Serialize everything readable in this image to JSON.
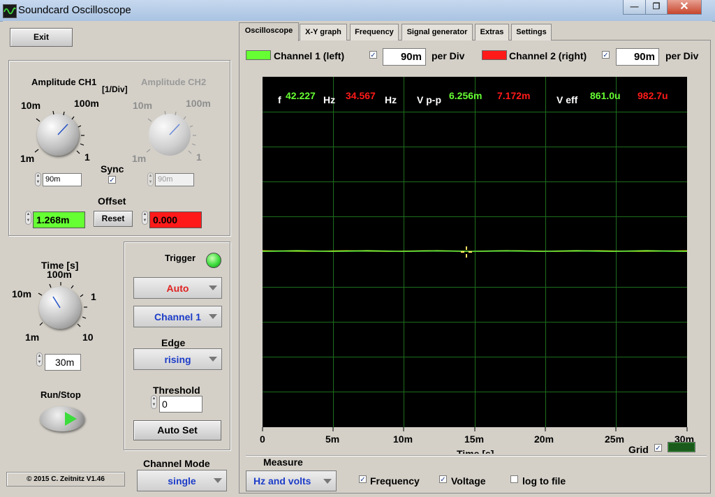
{
  "window": {
    "title": "Soundcard Oscilloscope"
  },
  "left": {
    "exit_label": "Exit",
    "amp_ch1_label": "Amplitude CH1",
    "amp_unit_label": "[1/Div]",
    "amp_ch2_label": "Amplitude CH2",
    "knob_ticks": {
      "t10m": "10m",
      "t100m": "100m",
      "t1m": "1m",
      "t1": "1"
    },
    "sync_label": "Sync",
    "ch1_amp_value": "90m",
    "ch2_amp_value": "90m",
    "offset_label": "Offset",
    "offset_ch1": "1.268m",
    "offset_ch2": "0.000",
    "reset_label": "Reset",
    "time_label": "Time [s]",
    "time_ticks": {
      "t100m": "100m",
      "t10m": "10m",
      "t1": "1",
      "t1m": "1m",
      "t10": "10"
    },
    "time_value": "30m",
    "runstop_label": "Run/Stop",
    "copyright": "© 2015  C. Zeitnitz V1.46",
    "channel_mode_label": "Channel Mode",
    "channel_mode_value": "single"
  },
  "trigger": {
    "label": "Trigger",
    "mode": "Auto",
    "channel": "Channel 1",
    "edge_label": "Edge",
    "edge": "rising",
    "threshold_label": "Threshold",
    "threshold_value": "0",
    "autoset_label": "Auto Set"
  },
  "tabs": [
    "Oscilloscope",
    "X-Y graph",
    "Frequency",
    "Signal generator",
    "Extras",
    "Settings"
  ],
  "channels": {
    "ch1_label": "Channel 1 (left)",
    "ch1_div": "90m",
    "ch2_label": "Channel 2 (right)",
    "ch2_div": "90m",
    "per_div": "per Div",
    "ch1_color": "#66ff33",
    "ch2_color": "#ff1a1a"
  },
  "measurements": {
    "f_label": "f",
    "f1": "42.227",
    "hz1": "Hz",
    "f2": "34.567",
    "hz2": "Hz",
    "vpp_label": "V p-p",
    "vpp1": "6.256m",
    "vpp2": "7.172m",
    "veff_label": "V eff",
    "veff1": "861.0u",
    "veff2": "982.7u"
  },
  "xaxis": {
    "ticks": [
      "0",
      "5m",
      "10m",
      "15m",
      "20m",
      "25m",
      "30m"
    ],
    "label": "Time [s]"
  },
  "grid_label": "Grid",
  "measure": {
    "label": "Measure",
    "value": "Hz and volts",
    "frequency_label": "Frequency",
    "voltage_label": "Voltage",
    "log_label": "log to file"
  }
}
